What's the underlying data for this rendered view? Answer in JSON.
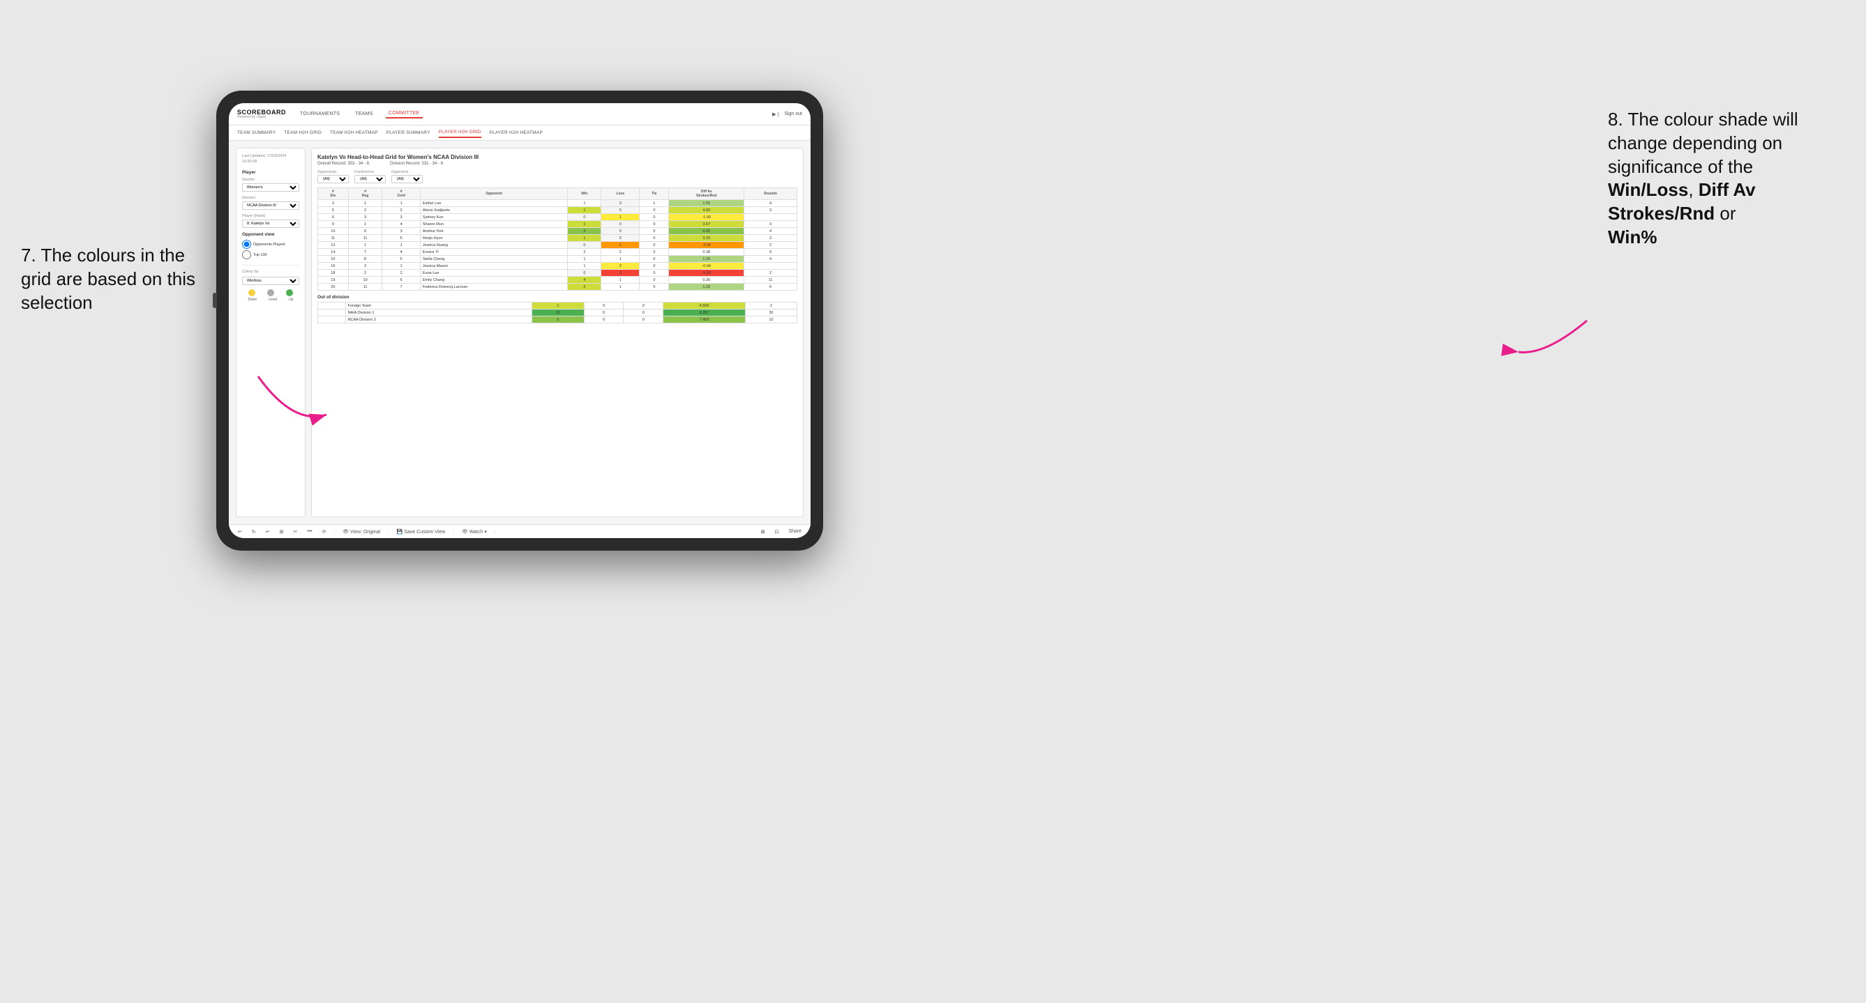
{
  "annotations": {
    "left_title": "7. The colours in the grid are based on this selection",
    "right_title": "8. The colour shade will change depending on significance of the",
    "right_bold1": "Win/Loss",
    "right_comma": ", ",
    "right_bold2": "Diff Av Strokes/Rnd",
    "right_or": " or",
    "right_bold3": "Win%"
  },
  "header": {
    "logo": "SCOREBOARD",
    "logo_sub": "Powered by clippd",
    "nav": [
      "TOURNAMENTS",
      "TEAMS",
      "COMMITTEE"
    ],
    "active_nav": "COMMITTEE",
    "sign_out": "Sign out"
  },
  "sub_nav": {
    "items": [
      "TEAM SUMMARY",
      "TEAM H2H GRID",
      "TEAM H2H HEATMAP",
      "PLAYER SUMMARY",
      "PLAYER H2H GRID",
      "PLAYER H2H HEATMAP"
    ],
    "active": "PLAYER H2H GRID"
  },
  "sidebar": {
    "last_updated_label": "Last Updated: 27/03/2024",
    "last_updated_time": "16:55:38",
    "player_section": "Player",
    "gender_label": "Gender",
    "gender_value": "Women's",
    "division_label": "Division",
    "division_value": "NCAA Division III",
    "player_rank_label": "Player (Rank)",
    "player_rank_value": "8. Katelyn Vo",
    "opponent_view_label": "Opponent view",
    "opponent_played": "Opponents Played",
    "top_100": "Top 100",
    "colour_by_label": "Colour by",
    "colour_by_value": "Win/loss",
    "legend_down": "Down",
    "legend_level": "Level",
    "legend_up": "Up"
  },
  "grid": {
    "title": "Katelyn Vo Head-to-Head Grid for Women's NCAA Division III",
    "overall_record_label": "Overall Record:",
    "overall_record_value": "353 - 34 - 6",
    "division_record_label": "Division Record:",
    "division_record_value": "331 - 34 - 6",
    "filter_opponents_label": "Opponents:",
    "filter_opponents_value": "(All)",
    "filter_conference_label": "Conference",
    "filter_conference_value": "(All)",
    "filter_opponent_label": "Opponent",
    "filter_opponent_value": "(All)",
    "col_headers": [
      "#\nDiv",
      "#\nReg",
      "#\nConf",
      "Opponent",
      "Win",
      "Loss",
      "Tie",
      "Diff Av\nStrokes/Rnd",
      "Rounds"
    ],
    "rows": [
      {
        "div": "3",
        "reg": "1",
        "conf": "1",
        "opponent": "Esther Lee",
        "win": "1",
        "loss": "0",
        "tie": "1",
        "diff": "1.50",
        "rounds": "4",
        "win_class": "td-neutral",
        "loss_class": "td-zero",
        "diff_class": "td-pos-medium"
      },
      {
        "div": "5",
        "reg": "2",
        "conf": "2",
        "opponent": "Alexis Sudjianto",
        "win": "1",
        "loss": "0",
        "tie": "0",
        "diff": "4.00",
        "rounds": "3",
        "win_class": "td-win-light",
        "loss_class": "td-zero",
        "diff_class": "td-win-light"
      },
      {
        "div": "6",
        "reg": "3",
        "conf": "3",
        "opponent": "Sydney Kuo",
        "win": "0",
        "loss": "1",
        "tie": "0",
        "diff": "-1.00",
        "rounds": "",
        "win_class": "td-zero",
        "loss_class": "td-loss-light",
        "diff_class": "td-loss-light"
      },
      {
        "div": "9",
        "reg": "1",
        "conf": "4",
        "opponent": "Sharon Mun",
        "win": "1",
        "loss": "0",
        "tie": "0",
        "diff": "3.67",
        "rounds": "3",
        "win_class": "td-win-light",
        "loss_class": "td-zero",
        "diff_class": "td-win-light"
      },
      {
        "div": "10",
        "reg": "6",
        "conf": "3",
        "opponent": "Andrea York",
        "win": "2",
        "loss": "0",
        "tie": "0",
        "diff": "4.00",
        "rounds": "4",
        "win_class": "td-win-medium",
        "loss_class": "td-zero",
        "diff_class": "td-win-medium"
      },
      {
        "div": "11",
        "reg": "11",
        "conf": "5",
        "opponent": "Heejo Hyun",
        "win": "1",
        "loss": "0",
        "tie": "0",
        "diff": "3.33",
        "rounds": "3",
        "win_class": "td-win-light",
        "loss_class": "td-zero",
        "diff_class": "td-win-light"
      },
      {
        "div": "13",
        "reg": "1",
        "conf": "1",
        "opponent": "Jessica Huang",
        "win": "0",
        "loss": "1",
        "tie": "0",
        "diff": "-3.00",
        "rounds": "2",
        "win_class": "td-zero",
        "loss_class": "td-loss-medium",
        "diff_class": "td-loss-medium"
      },
      {
        "div": "14",
        "reg": "7",
        "conf": "4",
        "opponent": "Eunice Yi",
        "win": "2",
        "loss": "2",
        "tie": "0",
        "diff": "0.38",
        "rounds": "9",
        "win_class": "td-neutral",
        "loss_class": "td-neutral",
        "diff_class": "td-neutral"
      },
      {
        "div": "15",
        "reg": "8",
        "conf": "5",
        "opponent": "Stella Cheng",
        "win": "1",
        "loss": "1",
        "tie": "0",
        "diff": "1.25",
        "rounds": "4",
        "win_class": "td-neutral",
        "loss_class": "td-neutral",
        "diff_class": "td-pos-medium"
      },
      {
        "div": "16",
        "reg": "3",
        "conf": "1",
        "opponent": "Jessica Mason",
        "win": "1",
        "loss": "2",
        "tie": "0",
        "diff": "-0.94",
        "rounds": "",
        "win_class": "td-neutral",
        "loss_class": "td-loss-light",
        "diff_class": "td-loss-light"
      },
      {
        "div": "18",
        "reg": "2",
        "conf": "2",
        "opponent": "Euna Lee",
        "win": "0",
        "loss": "3",
        "tie": "0",
        "diff": "-5.00",
        "rounds": "2",
        "win_class": "td-zero",
        "loss_class": "td-loss-strong",
        "diff_class": "td-loss-strong"
      },
      {
        "div": "19",
        "reg": "10",
        "conf": "6",
        "opponent": "Emily Chang",
        "win": "4",
        "loss": "1",
        "tie": "0",
        "diff": "0.30",
        "rounds": "11",
        "win_class": "td-win-light",
        "loss_class": "td-neutral",
        "diff_class": "td-neutral"
      },
      {
        "div": "20",
        "reg": "11",
        "conf": "7",
        "opponent": "Federica Domecq Lacroze",
        "win": "2",
        "loss": "1",
        "tie": "0",
        "diff": "1.33",
        "rounds": "6",
        "win_class": "td-win-light",
        "loss_class": "td-neutral",
        "diff_class": "td-pos-medium"
      }
    ],
    "out_of_division_label": "Out of division",
    "out_rows": [
      {
        "name": "Foreign Team",
        "win": "1",
        "loss": "0",
        "tie": "0",
        "diff": "4.500",
        "rounds": "2",
        "win_class": "td-win-light"
      },
      {
        "name": "NAIA Division 1",
        "win": "15",
        "loss": "0",
        "tie": "0",
        "diff": "9.267",
        "rounds": "30",
        "win_class": "td-win-strong"
      },
      {
        "name": "NCAA Division 2",
        "win": "5",
        "loss": "0",
        "tie": "0",
        "diff": "7.400",
        "rounds": "10",
        "win_class": "td-win-medium"
      }
    ]
  },
  "toolbar": {
    "buttons": [
      "↩",
      "↻",
      "↩",
      "⊞",
      "✂",
      "·",
      "⟳",
      "|",
      "👁 View: Original",
      "|",
      "💾 Save Custom View",
      "|",
      "👁 Watch ▾",
      "|",
      "⊠",
      "⊡",
      "Share"
    ]
  }
}
